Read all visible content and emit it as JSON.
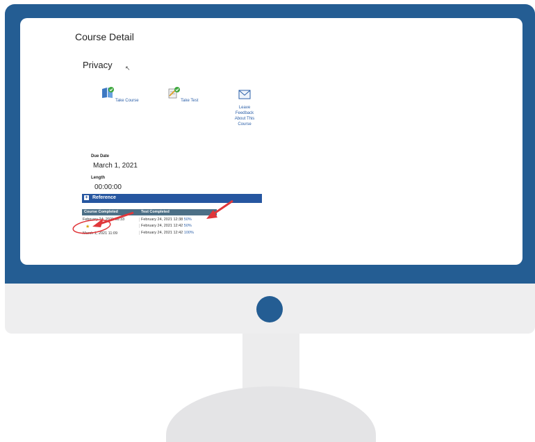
{
  "screen": {
    "heading": "Course Detail",
    "course_title": "Privacy",
    "actions": [
      {
        "name": "take-course",
        "label": "Take Course"
      },
      {
        "name": "take-test",
        "label": "Take Test"
      },
      {
        "name": "leave-feedback",
        "label_lines": [
          "Leave",
          "Feedback",
          "About This",
          "Course"
        ]
      }
    ],
    "due_date": {
      "label": "Due Date",
      "value": "March 1, 2021"
    },
    "length": {
      "label": "Length",
      "value": "00:00:00"
    },
    "reference": {
      "label": "Reference",
      "toggle": "+"
    },
    "history_table": {
      "headers": [
        "Course Completed",
        "Test Completed"
      ],
      "course_completed": [
        "February 24, 2021 08:33",
        "March 1, 2021 11:09"
      ],
      "test_completed": [
        {
          "date": "February 24, 2021 12:38",
          "score": "50%"
        },
        {
          "date": "February 24, 2021 12:42",
          "score": "50%"
        },
        {
          "date": "February 24, 2021 12:42",
          "score": "100%"
        }
      ]
    }
  },
  "colors": {
    "monitor_blue": "#245d93",
    "reference_bar": "#2656a0",
    "table_header": "#4c6f86",
    "annotation_red": "#e0363a"
  },
  "icons": [
    "book-check-icon",
    "test-check-icon",
    "envelope-icon",
    "cursor-icon"
  ]
}
